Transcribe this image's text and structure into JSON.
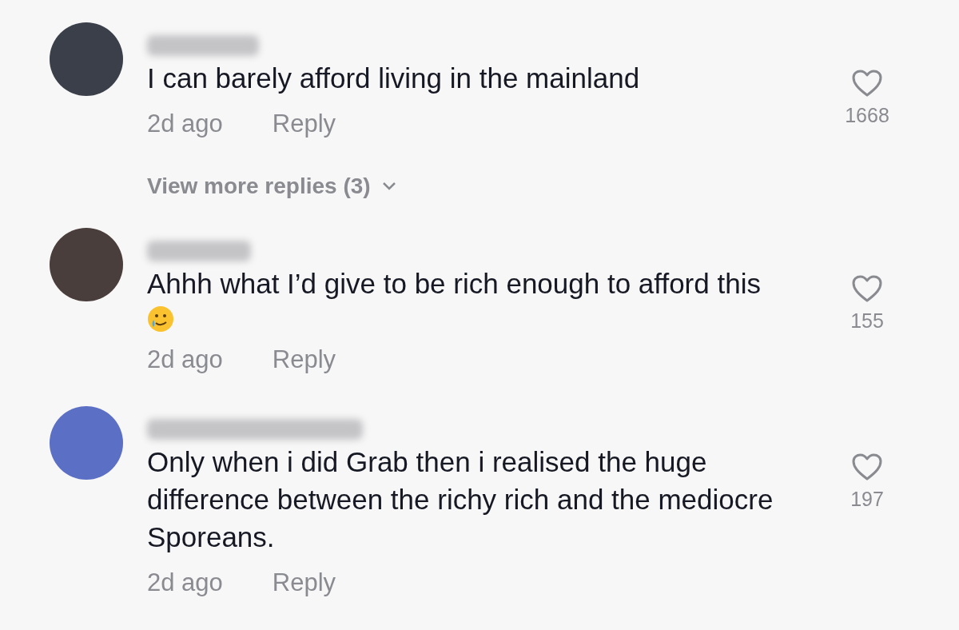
{
  "comments": [
    {
      "color": "#3a3f4a",
      "text": "I can barely afford living in the mainland",
      "crying_smile_emoji": false,
      "time": "2d ago",
      "reply": "Reply",
      "likes": "1668",
      "liked": false,
      "more_replies": "View more replies (3)"
    },
    {
      "color": "#4a3e3c",
      "text": "Ahhh what I’d give to be rich enough to afford this",
      "crying_smile_emoji": true,
      "time": "2d ago",
      "reply": "Reply",
      "likes": "155",
      "liked": false
    },
    {
      "color": "#5b6fc4",
      "text": "Only when i did Grab then i realised the huge difference between the richy rich and the mediocre Sporeans.",
      "crying_smile_emoji": false,
      "time": "2d ago",
      "reply": "Reply",
      "likes": "197",
      "liked": false
    }
  ]
}
